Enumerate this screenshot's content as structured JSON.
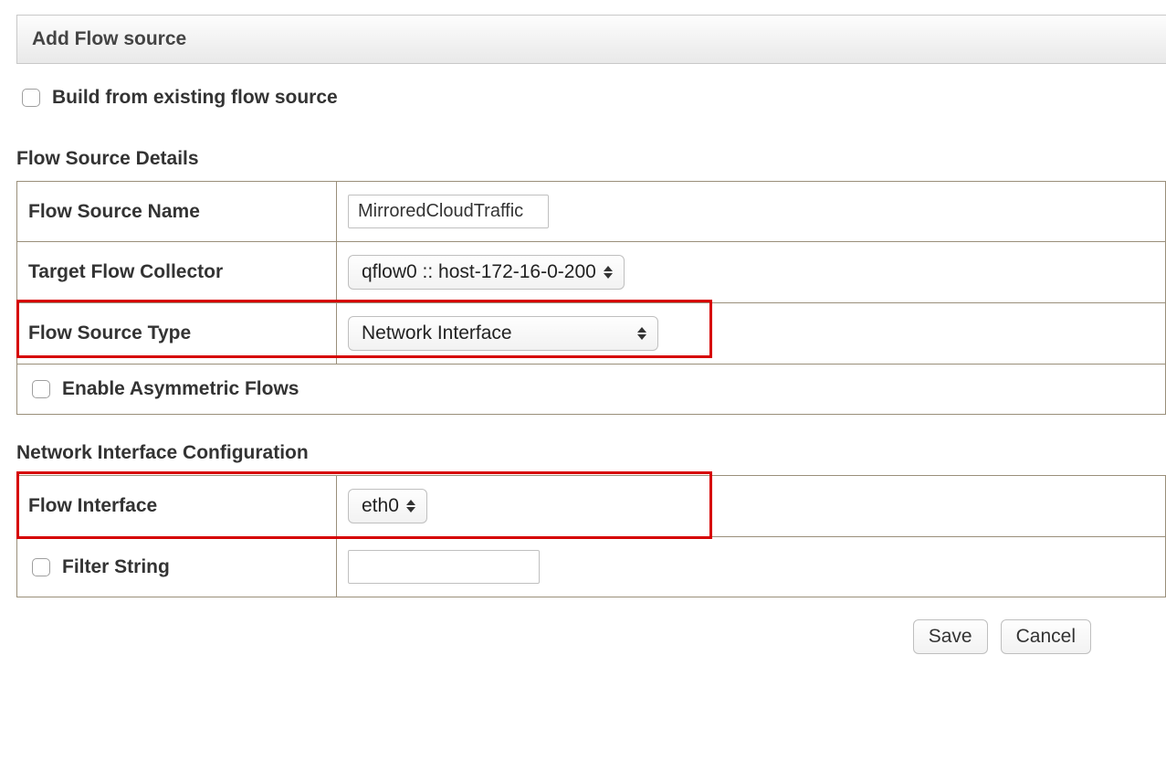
{
  "header": {
    "title": "Add Flow source"
  },
  "build_from_existing": {
    "label": "Build from existing flow source",
    "checked": false
  },
  "sections": {
    "details_heading": "Flow Source Details",
    "nic_heading": "Network Interface Configuration"
  },
  "details": {
    "flow_source_name": {
      "label": "Flow Source Name",
      "value": "MirroredCloudTraffic"
    },
    "target_flow_collector": {
      "label": "Target Flow Collector",
      "value": "qflow0 :: host-172-16-0-200"
    },
    "flow_source_type": {
      "label": "Flow Source Type",
      "value": "Network Interface"
    },
    "enable_async": {
      "label": "Enable Asymmetric Flows",
      "checked": false
    }
  },
  "nic": {
    "flow_interface": {
      "label": "Flow Interface",
      "value": "eth0"
    },
    "filter_string": {
      "label": "Filter String",
      "value": "",
      "checked": false
    }
  },
  "buttons": {
    "save": "Save",
    "cancel": "Cancel"
  }
}
